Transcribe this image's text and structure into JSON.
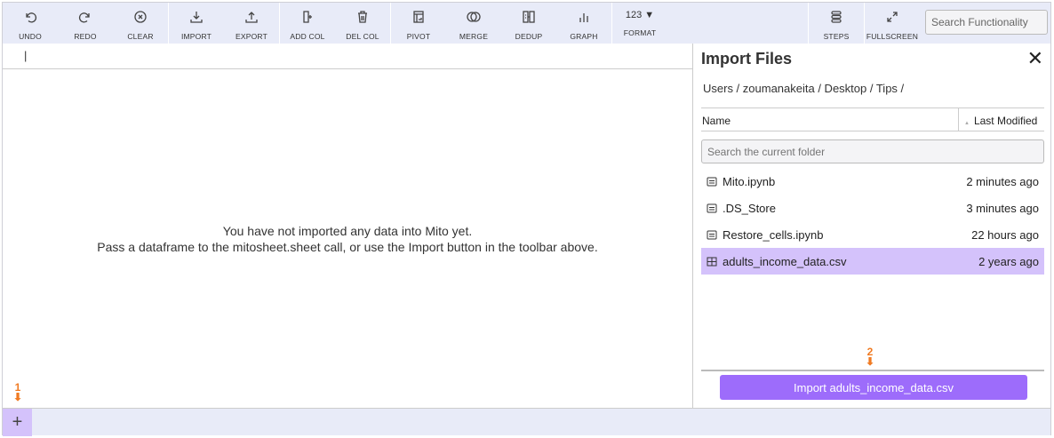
{
  "toolbar": {
    "buttons": [
      {
        "label": "UNDO",
        "icon": "undo-icon"
      },
      {
        "label": "REDO",
        "icon": "redo-icon"
      },
      {
        "label": "CLEAR",
        "icon": "clear-icon"
      },
      {
        "label": "IMPORT",
        "icon": "import-icon"
      },
      {
        "label": "EXPORT",
        "icon": "export-icon"
      },
      {
        "label": "ADD COL",
        "icon": "add-column-icon"
      },
      {
        "label": "DEL COL",
        "icon": "trash-icon"
      },
      {
        "label": "PIVOT",
        "icon": "pivot-icon"
      },
      {
        "label": "MERGE",
        "icon": "merge-icon"
      },
      {
        "label": "DEDUP",
        "icon": "dedup-icon"
      },
      {
        "label": "GRAPH",
        "icon": "graph-icon"
      }
    ],
    "format": {
      "top": "123 ▼",
      "label": "FORMAT"
    },
    "steps": "STEPS",
    "fullscreen": "FULLSCREEN",
    "search_placeholder": "Search Functionality"
  },
  "formula_bar": {
    "value": "|"
  },
  "empty_message": {
    "line1": "You have not imported any data into Mito yet.",
    "line2": "Pass a dataframe to the mitosheet.sheet call, or use the Import button in the toolbar above."
  },
  "import_panel": {
    "title": "Import Files",
    "close": "✕",
    "breadcrumb": "Users / zoumanakeita / Desktop / Tips /",
    "columns": {
      "name": "Name",
      "modified": "Last Modified",
      "sort_indicator": "▲"
    },
    "search_placeholder": "Search the current folder",
    "files": [
      {
        "name": "Mito.ipynb",
        "modified": "2 minutes ago",
        "type": "file"
      },
      {
        "name": ".DS_Store",
        "modified": "3 minutes ago",
        "type": "file"
      },
      {
        "name": "Restore_cells.ipynb",
        "modified": "22 hours ago",
        "type": "file"
      },
      {
        "name": "adults_income_data.csv",
        "modified": "2 years ago",
        "type": "table",
        "selected": true
      }
    ],
    "import_button": "Import adults_income_data.csv"
  },
  "annotations": {
    "one": "1",
    "two": "2",
    "arrow": "⬇"
  },
  "footer": {
    "add_sheet": "+"
  },
  "colors": {
    "accent": "#9d6cfb",
    "selected": "#d4c2fb",
    "toolbar_bg": "#e8ebf8",
    "annotation": "#f07a22"
  }
}
